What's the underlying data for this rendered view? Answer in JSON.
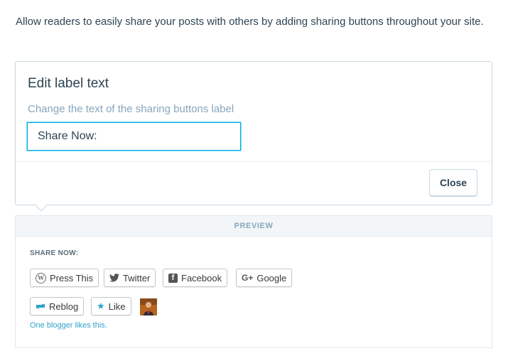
{
  "intro_text": "Allow readers to easily share your posts with others by adding sharing buttons throughout your site.",
  "editor": {
    "title": "Edit label text",
    "description": "Change the text of the sharing buttons label",
    "input_value": "Share Now:",
    "close_label": "Close"
  },
  "preview": {
    "header": "PREVIEW",
    "share_label": "SHARE NOW:",
    "buttons": [
      {
        "label": "Press This",
        "icon": "wordpress-icon"
      },
      {
        "label": "Twitter",
        "icon": "twitter-icon"
      },
      {
        "label": "Facebook",
        "icon": "facebook-icon"
      },
      {
        "label": "Google",
        "icon": "google-plus-icon"
      }
    ],
    "reblog_label": "Reblog",
    "like_label": "Like",
    "likes_text": "One blogger likes this."
  },
  "colors": {
    "accent": "#00aadc",
    "muted": "#87a6bc",
    "link": "#2ea2cc",
    "text": "#2e4453"
  }
}
